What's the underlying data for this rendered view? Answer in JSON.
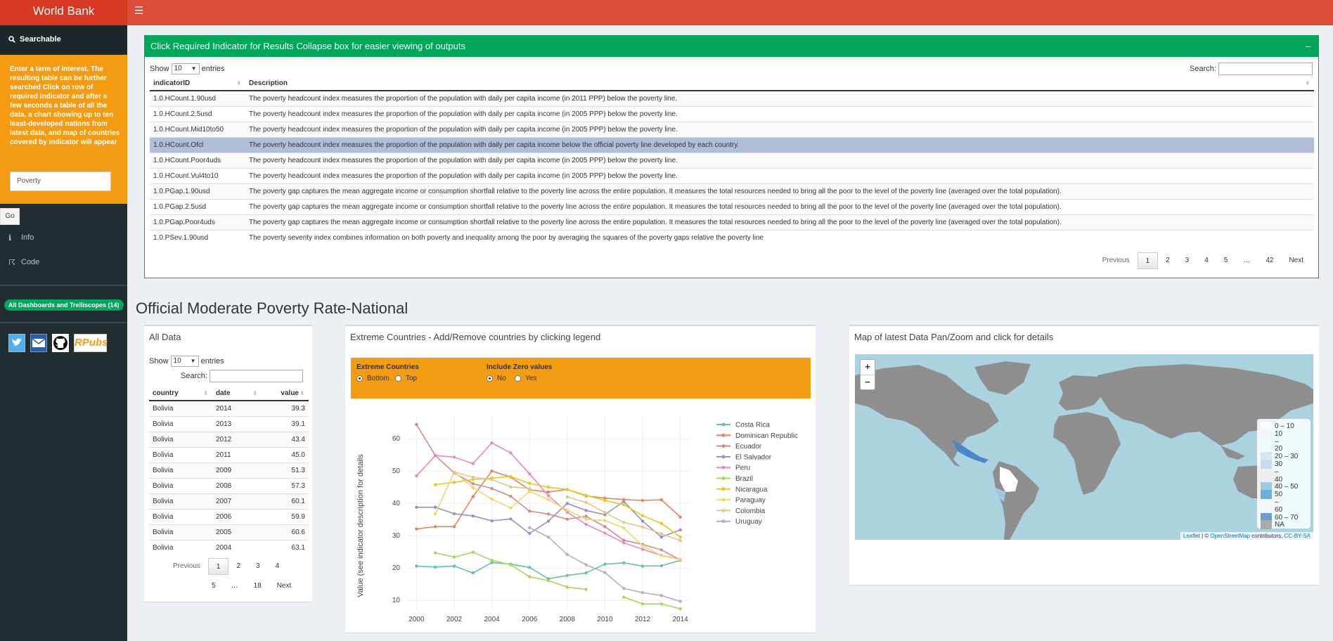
{
  "header": {
    "logo": "World Bank",
    "menu_icon": "☰"
  },
  "sidebar": {
    "search_title": "Searchable",
    "instructions": "Enter a term of interest. The resulting table can be further searched Click on row of required indicator and after a few seconds a table of all the data, a chart showing up to ten least-developed nations from latest data, and map of countries covered by indicator will appear",
    "search_value": "Poverty",
    "go_label": "Go",
    "menu": [
      {
        "icon": "ℹ",
        "label": "Info"
      },
      {
        "icon": "☈",
        "label": "Code"
      }
    ],
    "badge": "All Dashboards and Trelliscopes (14)",
    "social": [
      "twitter-icon",
      "email-icon",
      "github-icon",
      "rpubs-icon"
    ],
    "rpubs": "RPubs"
  },
  "indicator_box": {
    "title": "Click Required Indicator for Results Collapse box for easier viewing of outputs",
    "collapse": "−",
    "show": "Show",
    "entries_value": "10",
    "entries": "entries",
    "search": "Search:",
    "columns": [
      "indicatorID",
      "Description"
    ],
    "rows": [
      [
        "1.0.HCount.1.90usd",
        "The poverty headcount index measures the proportion of the population with daily per capita income (in 2011 PPP) below the poverty line."
      ],
      [
        "1.0.HCount.2.5usd",
        "The poverty headcount index measures the proportion of the population with daily per capita income (in 2005 PPP) below the poverty line."
      ],
      [
        "1.0.HCount.Mid10to50",
        "The poverty headcount index measures the proportion of the population with daily per capita income (in 2005 PPP) below the poverty line."
      ],
      [
        "1.0.HCount.Ofcl",
        "The poverty headcount index measures the proportion of the population with daily per capita income below the official poverty line developed by each country."
      ],
      [
        "1.0.HCount.Poor4uds",
        "The poverty headcount index measures the proportion of the population with daily per capita income (in 2005 PPP) below the poverty line."
      ],
      [
        "1.0.HCount.Vul4to10",
        "The poverty headcount index measures the proportion of the population with daily per capita income (in 2005 PPP) below the poverty line."
      ],
      [
        "1.0.PGap.1.90usd",
        "The poverty gap captures the mean aggregate income or consumption shortfall relative to the poverty line across the entire population. It measures the total resources needed to bring all the poor to the level of the poverty line (averaged over the total population)."
      ],
      [
        "1.0.PGap.2.5usd",
        "The poverty gap captures the mean aggregate income or consumption shortfall relative to the poverty line across the entire population. It measures the total resources needed to bring all the poor to the level of the poverty line (averaged over the total population)."
      ],
      [
        "1.0.PGap.Poor4uds",
        "The poverty gap captures the mean aggregate income or consumption shortfall relative to the poverty line across the entire population. It measures the total resources needed to bring all the poor to the level of the poverty line (averaged over the total population)."
      ],
      [
        "1.0.PSev.1.90usd",
        "The poverty severity index combines information on both poverty and inequality among the poor by averaging the squares of the poverty gaps relative the poverty line"
      ]
    ],
    "pager": [
      "Previous",
      "1",
      "2",
      "3",
      "4",
      "5",
      "…",
      "42",
      "Next"
    ]
  },
  "page_title": "Official Moderate Poverty Rate-National",
  "all_data": {
    "title": "All Data",
    "show": "Show",
    "entries_value": "10",
    "entries": "entries",
    "search": "Search:",
    "columns": [
      "country",
      "date",
      "value"
    ],
    "rows": [
      [
        "Bolivia",
        "2014",
        "39.3"
      ],
      [
        "Bolivia",
        "2013",
        "39.1"
      ],
      [
        "Bolivia",
        "2012",
        "43.4"
      ],
      [
        "Bolivia",
        "2011",
        "45.0"
      ],
      [
        "Bolivia",
        "2009",
        "51.3"
      ],
      [
        "Bolivia",
        "2008",
        "57.3"
      ],
      [
        "Bolivia",
        "2007",
        "60.1"
      ],
      [
        "Bolivia",
        "2006",
        "59.9"
      ],
      [
        "Bolivia",
        "2005",
        "60.6"
      ],
      [
        "Bolivia",
        "2004",
        "63.1"
      ]
    ],
    "pager_row1": [
      "Previous",
      "1",
      "2",
      "3",
      "4"
    ],
    "pager_row2": [
      "5",
      "…",
      "18",
      "Next"
    ]
  },
  "extreme": {
    "title": "Extreme Countries - Add/Remove countries by clicking legend",
    "ctrl1_label": "Extreme Countries",
    "ctrl1_options": [
      "Bottom",
      "Top"
    ],
    "ctrl2_label": "Include Zero values",
    "ctrl2_options": [
      "No",
      "Yes"
    ]
  },
  "map": {
    "title": "Map of latest Data Pan/Zoom and click for details",
    "zoom_in": "+",
    "zoom_out": "−",
    "legend": [
      {
        "label": "0 – 10",
        "color": "#f7fbff"
      },
      {
        "label": "10",
        "color": "#eef5fc"
      },
      {
        "label": "–",
        "color": ""
      },
      {
        "label": "20",
        "color": ""
      },
      {
        "label": "20 – 30",
        "color": "#d6e6f4"
      },
      {
        "label": "30",
        "color": "#c6dbef"
      },
      {
        "label": "–",
        "color": ""
      },
      {
        "label": "40",
        "color": ""
      },
      {
        "label": "40 – 50",
        "color": "#9ecae1"
      },
      {
        "label": "50",
        "color": "#6baed6"
      },
      {
        "label": "–",
        "color": ""
      },
      {
        "label": "60",
        "color": ""
      },
      {
        "label": "60 – 70",
        "color": "#6a9fd0"
      },
      {
        "label": "NA",
        "color": "#aaaaaa"
      }
    ],
    "attribution_leaflet": "Leaflet",
    "attribution_mid": " | © ",
    "attribution_osm": "OpenStreetMap",
    "attribution_rest": " contributors, ",
    "attribution_cc": "CC-BY-SA"
  },
  "chart_data": {
    "type": "line",
    "ylabel": "Value (see indicator description for details",
    "xlabel": "",
    "xlim": [
      1999.5,
      2014.5
    ],
    "ylim": [
      7,
      67
    ],
    "xticks": [
      2000,
      2002,
      2004,
      2006,
      2008,
      2010,
      2012,
      2014
    ],
    "yticks": [
      10,
      20,
      30,
      40,
      50,
      60
    ],
    "series": [
      {
        "name": "Costa Rica",
        "color": "#66c2a5",
        "points": [
          [
            2000,
            20.6
          ],
          [
            2001,
            20.3
          ],
          [
            2002,
            20.6
          ],
          [
            2003,
            18.5
          ],
          [
            2004,
            21.7
          ],
          [
            2005,
            21.2
          ],
          [
            2006,
            20.2
          ],
          [
            2007,
            16.7
          ],
          [
            2008,
            17.7
          ],
          [
            2009,
            18.5
          ],
          [
            2010,
            21.2
          ],
          [
            2011,
            21.6
          ],
          [
            2012,
            20.6
          ],
          [
            2013,
            20.7
          ],
          [
            2014,
            22.4
          ]
        ]
      },
      {
        "name": "Dominican Republic",
        "color": "#e6845e",
        "points": [
          [
            2000,
            32.1
          ],
          [
            2001,
            32.8
          ],
          [
            2002,
            32.8
          ],
          [
            2003,
            42.1
          ],
          [
            2004,
            50
          ],
          [
            2005,
            48.1
          ],
          [
            2006,
            44.2
          ],
          [
            2007,
            43.5
          ],
          [
            2008,
            44.3
          ],
          [
            2009,
            42.3
          ],
          [
            2010,
            41.6
          ],
          [
            2011,
            41.2
          ],
          [
            2012,
            40.9
          ],
          [
            2013,
            41.1
          ],
          [
            2014,
            35.8
          ]
        ]
      },
      {
        "name": "Ecuador",
        "color": "#d18b8b",
        "points": [
          [
            2000,
            64.4
          ],
          [
            2001,
            54.8
          ],
          [
            2002,
            49.4
          ],
          [
            2003,
            46.1
          ],
          [
            2004,
            44.6
          ],
          [
            2005,
            42.2
          ],
          [
            2006,
            37.6
          ],
          [
            2007,
            36.7
          ],
          [
            2008,
            35.1
          ],
          [
            2009,
            36
          ],
          [
            2010,
            32.8
          ],
          [
            2011,
            28.6
          ],
          [
            2012,
            27.3
          ],
          [
            2013,
            25.6
          ],
          [
            2014,
            22.5
          ]
        ]
      },
      {
        "name": "El Salvador",
        "color": "#9c8ec4",
        "points": [
          [
            2000,
            38.8
          ],
          [
            2001,
            38.8
          ],
          [
            2002,
            36.8
          ],
          [
            2003,
            36.1
          ],
          [
            2004,
            34.6
          ],
          [
            2005,
            35.2
          ],
          [
            2006,
            30.7
          ],
          [
            2007,
            34.5
          ],
          [
            2008,
            40
          ],
          [
            2009,
            37.8
          ],
          [
            2010,
            36.5
          ],
          [
            2011,
            40.6
          ],
          [
            2012,
            34.5
          ],
          [
            2013,
            29.6
          ],
          [
            2014,
            31.8
          ]
        ]
      },
      {
        "name": "Peru",
        "color": "#e78ac3",
        "points": [
          [
            2000,
            48.5
          ],
          [
            2001,
            54.8
          ],
          [
            2002,
            54.3
          ],
          [
            2003,
            52.3
          ],
          [
            2004,
            58.7
          ],
          [
            2005,
            55.6
          ],
          [
            2006,
            49.1
          ],
          [
            2007,
            42.4
          ],
          [
            2008,
            37.3
          ],
          [
            2009,
            33.5
          ],
          [
            2010,
            30.8
          ],
          [
            2011,
            27.8
          ],
          [
            2012,
            25.8
          ],
          [
            2013,
            23.9
          ],
          [
            2014,
            22.7
          ]
        ]
      },
      {
        "name": "Brazil",
        "color": "#a6d854",
        "points": [
          [
            2001,
            24.7
          ],
          [
            2002,
            23.4
          ],
          [
            2003,
            24.9
          ],
          [
            2004,
            22.4
          ],
          [
            2005,
            21
          ],
          [
            2006,
            17.3
          ],
          [
            2007,
            16.1
          ],
          [
            2008,
            14.1
          ],
          [
            2009,
            13.4
          ],
          [
            2010,
            null
          ],
          [
            2011,
            11
          ],
          [
            2012,
            8.9
          ],
          [
            2013,
            8.9
          ],
          [
            2014,
            7.4
          ]
        ]
      },
      {
        "name": "Nicaragua",
        "color": "#e5c91f",
        "points": [
          [
            2001,
            45.8
          ],
          [
            2002,
            46.5
          ],
          [
            2003,
            47.4
          ],
          [
            2004,
            47.8
          ],
          [
            2005,
            48.3
          ],
          [
            2006,
            46.2
          ],
          [
            2007,
            45
          ],
          [
            2008,
            44.3
          ],
          [
            2009,
            42.5
          ],
          [
            2010,
            40.9
          ],
          [
            2011,
            39.6
          ],
          [
            2012,
            36.2
          ],
          [
            2013,
            33.8
          ],
          [
            2014,
            29.6
          ]
        ]
      },
      {
        "name": "Paraguay",
        "color": "#f0d76a",
        "points": [
          [
            2001,
            36.8
          ],
          [
            2002,
            49.7
          ],
          [
            2003,
            44.9
          ],
          [
            2004,
            41.3
          ],
          [
            2005,
            38.6
          ],
          [
            2006,
            43.7
          ],
          [
            2007,
            41.2
          ],
          [
            2008,
            37.9
          ],
          [
            2009,
            35.1
          ],
          [
            2010,
            34.7
          ],
          [
            2011,
            32.4
          ],
          [
            2012,
            26.9
          ],
          [
            2013,
            23.8
          ],
          [
            2014,
            22.6
          ]
        ]
      },
      {
        "name": "Colombia",
        "color": "#e5c494",
        "points": [
          [
            2002,
            49.7
          ],
          [
            2003,
            48.1
          ],
          [
            2004,
            47.4
          ],
          [
            2005,
            45.1
          ],
          [
            2006,
            44.6
          ],
          [
            2007,
            null
          ],
          [
            2008,
            42.0
          ],
          [
            2009,
            40.3
          ],
          [
            2010,
            37.2
          ],
          [
            2011,
            34.1
          ],
          [
            2012,
            32.7
          ],
          [
            2013,
            30.6
          ],
          [
            2014,
            28.5
          ]
        ]
      },
      {
        "name": "Uruguay",
        "color": "#b3b3b3",
        "points": [
          [
            2006,
            32.5
          ],
          [
            2007,
            29.6
          ],
          [
            2008,
            24.2
          ],
          [
            2009,
            21
          ],
          [
            2010,
            18.6
          ],
          [
            2011,
            13.7
          ],
          [
            2012,
            12.4
          ],
          [
            2013,
            11.5
          ],
          [
            2014,
            9.7
          ]
        ]
      }
    ]
  }
}
